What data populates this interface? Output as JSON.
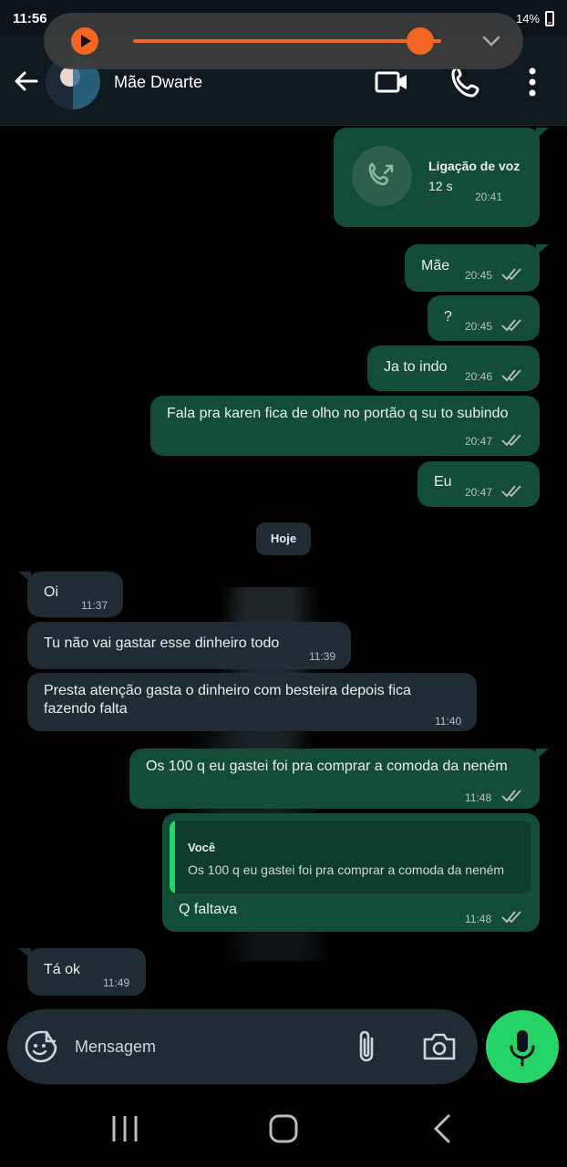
{
  "status": {
    "time": "11:56",
    "battery": "14%"
  },
  "header": {
    "contact_name": "Mãe Dwarte"
  },
  "call": {
    "title": "Ligação de voz",
    "duration": "12 s",
    "time": "20:41"
  },
  "messages": [
    {
      "text": "Mãe",
      "time": "20:45"
    },
    {
      "text": "?",
      "time": "20:45"
    },
    {
      "text": "Ja to indo",
      "time": "20:46"
    },
    {
      "text": "Fala pra karen fica de olho no portão q su to subindo",
      "time": "20:47"
    },
    {
      "text": "Eu",
      "time": "20:47"
    },
    {
      "text": "Oi",
      "time": "11:37"
    },
    {
      "text": "Tu não vai gastar esse dinheiro todo",
      "time": "11:39"
    },
    {
      "text": "Presta atenção gasta o dinheiro com besteira depois fica",
      "text2": "fazendo falta",
      "time": "11:40"
    },
    {
      "text": "Os 100 q eu gastei foi pra comprar a comoda da neném",
      "time": "11:48"
    },
    {
      "text": "Q faltava",
      "time": "11:48",
      "quote_author": "Você",
      "quote_text": "Os 100 q eu gastei foi pra comprar a comoda da neném"
    },
    {
      "text": "Tá ok",
      "time": "11:49"
    }
  ],
  "day_separator": "Hoje",
  "composer": {
    "placeholder": "Mensagem"
  },
  "colors": {
    "outgoing_bubble": "#144d37",
    "incoming_bubble": "#1f2c34",
    "accent": "#25d366",
    "audio_accent": "#f26522"
  },
  "icons": [
    "back-arrow-icon",
    "video-call-icon",
    "voice-call-icon",
    "more-options-icon",
    "play-icon",
    "chevron-down-icon",
    "outgoing-call-icon",
    "double-check-icon",
    "sticker-icon",
    "attach-icon",
    "camera-icon",
    "mic-icon",
    "recents-nav-icon",
    "home-nav-icon",
    "back-nav-icon"
  ]
}
